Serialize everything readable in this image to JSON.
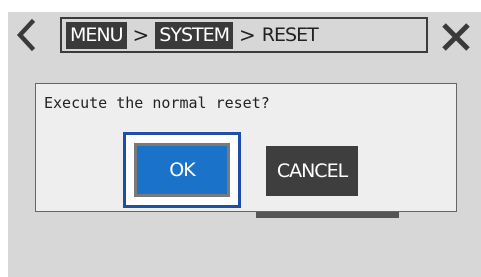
{
  "header": {
    "back_icon": "chevron-left-icon",
    "close_icon": "close-x-icon",
    "breadcrumb": {
      "items": [
        "MENU",
        "SYSTEM"
      ],
      "separator": ">",
      "current": "RESET"
    }
  },
  "dialog": {
    "message": "Execute the normal reset?",
    "ok_label": "OK",
    "cancel_label": "CANCEL"
  },
  "colors": {
    "panel_background": "#d7d7d7",
    "ok_button": "#1a73c8",
    "cancel_button": "#3e3e3e",
    "focus_ring": "#1f4ea8",
    "breadcrumb_box": "#3a3a3a"
  }
}
